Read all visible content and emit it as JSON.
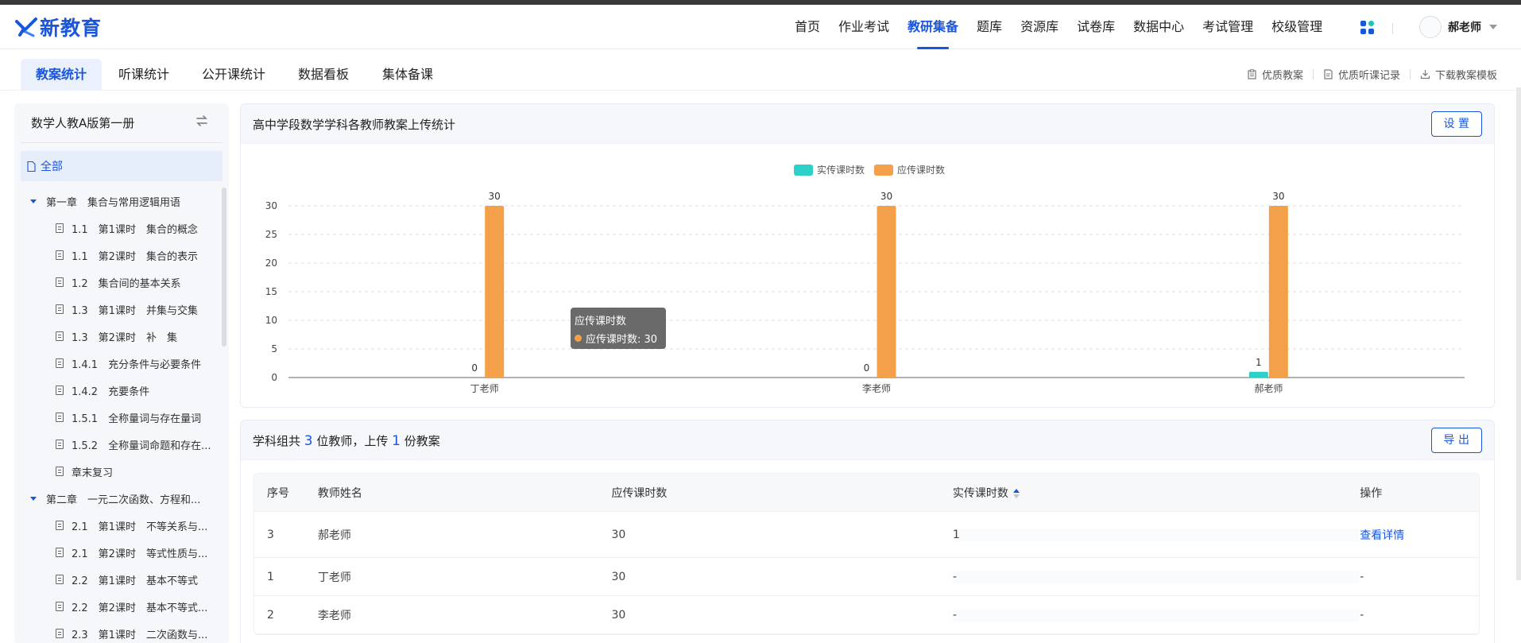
{
  "app": {
    "logo_text": "新教育",
    "brand_color": "#1a56db"
  },
  "nav": {
    "items": [
      {
        "label": "首页",
        "active": false
      },
      {
        "label": "作业考试",
        "active": false
      },
      {
        "label": "教研集备",
        "active": true
      },
      {
        "label": "题库",
        "active": false
      },
      {
        "label": "资源库",
        "active": false
      },
      {
        "label": "试卷库",
        "active": false
      },
      {
        "label": "数据中心",
        "active": false
      },
      {
        "label": "考试管理",
        "active": false
      },
      {
        "label": "校级管理",
        "active": false
      }
    ],
    "grid_icon": "apps-grid-icon",
    "user_name": "郝老师"
  },
  "subnav": {
    "tabs": [
      {
        "label": "教案统计",
        "active": true
      },
      {
        "label": "听课统计",
        "active": false
      },
      {
        "label": "公开课统计",
        "active": false
      },
      {
        "label": "数据看板",
        "active": false
      },
      {
        "label": "集体备课",
        "active": false
      }
    ],
    "tools": [
      {
        "label": "优质教案",
        "icon": "clipboard-icon"
      },
      {
        "label": "优质听课记录",
        "icon": "note-icon"
      },
      {
        "label": "下载教案模板",
        "icon": "download-icon"
      }
    ]
  },
  "sidebar": {
    "title": "数学人教A版第一册",
    "all_label": "全部",
    "tree": [
      {
        "type": "chapter",
        "label": "第一章　集合与常用逻辑用语"
      },
      {
        "type": "lesson",
        "label": "1.1　第1课时　集合的概念"
      },
      {
        "type": "lesson",
        "label": "1.1　第2课时　集合的表示"
      },
      {
        "type": "lesson",
        "label": "1.2　集合间的基本关系"
      },
      {
        "type": "lesson",
        "label": "1.3　第1课时　并集与交集"
      },
      {
        "type": "lesson",
        "label": "1.3　第2课时　补　集"
      },
      {
        "type": "lesson",
        "label": "1.4.1　充分条件与必要条件"
      },
      {
        "type": "lesson",
        "label": "1.4.2　充要条件"
      },
      {
        "type": "lesson",
        "label": "1.5.1　全称量词与存在量词"
      },
      {
        "type": "lesson",
        "label": "1.5.2　全称量词命题和存在..."
      },
      {
        "type": "lesson",
        "label": "章末复习"
      },
      {
        "type": "chapter",
        "label": "第二章　一元二次函数、方程和..."
      },
      {
        "type": "lesson",
        "label": "2.1　第1课时　不等关系与..."
      },
      {
        "type": "lesson",
        "label": "2.1　第2课时　等式性质与..."
      },
      {
        "type": "lesson",
        "label": "2.2　第1课时　基本不等式"
      },
      {
        "type": "lesson",
        "label": "2.2　第2课时　基本不等式..."
      },
      {
        "type": "lesson",
        "label": "2.3　第1课时　二次函数与..."
      }
    ]
  },
  "chart_panel": {
    "title": "高中学段数学学科各教师教案上传统计",
    "settings_label": "设 置",
    "tooltip": {
      "title": "应传课时数",
      "line": "应传课时数: 30"
    }
  },
  "chart_data": {
    "type": "bar",
    "categories": [
      "丁老师",
      "李老师",
      "郝老师"
    ],
    "series": [
      {
        "name": "实传课时数",
        "values": [
          0,
          0,
          1
        ],
        "color": "#2ed1c7"
      },
      {
        "name": "应传课时数",
        "values": [
          30,
          30,
          30
        ],
        "color": "#f4a04a"
      }
    ],
    "ylim": [
      0,
      30
    ],
    "yticks": [
      0,
      5,
      10,
      15,
      20,
      25,
      30
    ],
    "grid": true,
    "legend_position": "top-center",
    "data_labels": true
  },
  "summary_panel": {
    "text_prefix": "学科组共 ",
    "teacher_count": "3",
    "text_mid": " 位教师，上传 ",
    "upload_count": "1",
    "text_suffix": " 份教案",
    "export_label": "导 出"
  },
  "table": {
    "headers": [
      "序号",
      "教师姓名",
      "应传课时数",
      "实传课时数",
      "操作"
    ],
    "rows": [
      {
        "index": "3",
        "name": "郝老师",
        "planned": "30",
        "actual": "1",
        "action": "查看详情"
      },
      {
        "index": "1",
        "name": "丁老师",
        "planned": "30",
        "actual": "-",
        "action": "-"
      },
      {
        "index": "2",
        "name": "李老师",
        "planned": "30",
        "actual": "-",
        "action": "-"
      }
    ]
  }
}
